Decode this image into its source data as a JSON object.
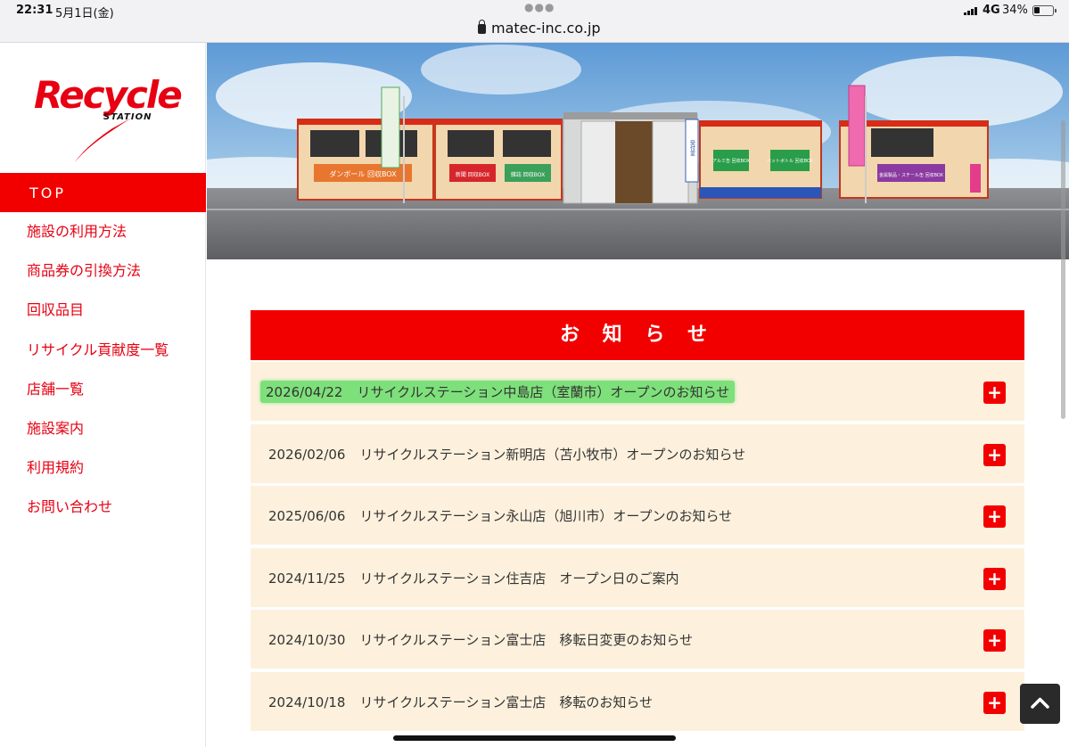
{
  "status_bar": {
    "time": "22:31",
    "date": "5月1日(金)",
    "url": "matec-inc.co.jp",
    "network": "4G",
    "battery": "34%",
    "battery_level": 0.34
  },
  "brand": {
    "logo_text": "Recycle",
    "logo_sub": "STATION",
    "accent_color": "#f20000"
  },
  "sidebar": {
    "active": "TOP",
    "items": [
      {
        "label": "施設の利用方法"
      },
      {
        "label": "商品券の引換方法"
      },
      {
        "label": "回収品目"
      },
      {
        "label": "リサイクル貢献度一覧"
      },
      {
        "label": "店舗一覧"
      },
      {
        "label": "施設案内"
      },
      {
        "label": "利用規約"
      },
      {
        "label": "お問い合わせ"
      }
    ]
  },
  "hero": {
    "signs": [
      "ダンボール 回収BOX",
      "新聞 回収BOX",
      "雑誌 回収BOX",
      "受付室",
      "アルミ缶 回収BOX",
      "ペットボトル 回収BOX",
      "金属製品・スチール缶 回収BOX"
    ]
  },
  "news": {
    "title": "お 知 ら せ",
    "items": [
      {
        "date": "2026/04/22",
        "text": "リサイクルステーション中島店（室蘭市）オープンのお知らせ"
      },
      {
        "date": "2026/02/06",
        "text": "リサイクルステーション新明店（苫小牧市）オープンのお知らせ"
      },
      {
        "date": "2025/06/06",
        "text": "リサイクルステーション永山店（旭川市）オープンのお知らせ"
      },
      {
        "date": "2024/11/25",
        "text": "リサイクルステーション住吉店　オープン日のご案内"
      },
      {
        "date": "2024/10/30",
        "text": "リサイクルステーション富士店　移転日変更のお知らせ"
      },
      {
        "date": "2024/10/18",
        "text": "リサイクルステーション富士店　移転のお知らせ"
      }
    ],
    "expand_label": "+"
  }
}
